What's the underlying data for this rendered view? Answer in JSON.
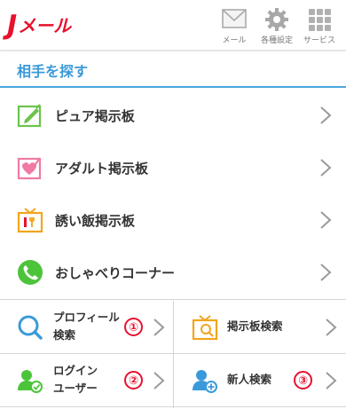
{
  "header": {
    "logo_j": "J",
    "logo_rest": "メール",
    "mail_label": "メール",
    "settings_label": "各種設定",
    "services_label": "サービス"
  },
  "section_title": "相手を探す",
  "menu": [
    {
      "label": "ピュア掲示板",
      "icon": "pure-board-icon"
    },
    {
      "label": "アダルト掲示板",
      "icon": "adult-board-icon"
    },
    {
      "label": "誘い飯掲示板",
      "icon": "meal-board-icon"
    },
    {
      "label": "おしゃべりコーナー",
      "icon": "phone-icon"
    }
  ],
  "grid": [
    {
      "line1": "プロフィール",
      "line2": "検索",
      "badge": "①",
      "icon": "search-icon"
    },
    {
      "line1": "掲示板検索",
      "line2": "",
      "badge": "",
      "icon": "board-search-icon"
    },
    {
      "line1": "ログイン",
      "line2": "ユーザー",
      "badge": "②",
      "icon": "login-user-icon"
    },
    {
      "line1": "新人検索",
      "line2": "",
      "badge": "③",
      "icon": "new-user-icon"
    }
  ],
  "colors": {
    "brand_red": "#e8112d",
    "accent_blue": "#3a9ad9"
  }
}
